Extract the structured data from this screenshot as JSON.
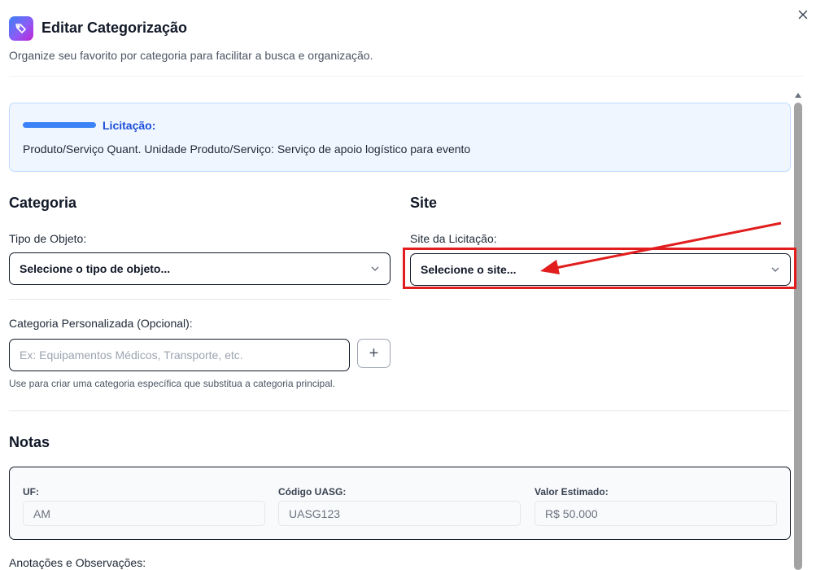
{
  "header": {
    "title": "Editar Categorização",
    "subtitle": "Organize seu favorito por categoria para facilitar a busca e organização.",
    "icon": "tag-icon",
    "close_icon": "close-icon"
  },
  "licitacao": {
    "label": "Licitação:",
    "description": "Produto/Serviço Quant. Unidade Produto/Serviço: Serviço de apoio logístico para evento"
  },
  "categoria": {
    "title": "Categoria",
    "tipo_label": "Tipo de Objeto:",
    "tipo_value": "Selecione o tipo de objeto...",
    "custom_label": "Categoria Personalizada (Opcional):",
    "custom_placeholder": "Ex: Equipamentos Médicos, Transporte, etc.",
    "add_label": "+",
    "hint": "Use para criar uma categoria específica que substitua a categoria principal."
  },
  "site": {
    "title": "Site",
    "label": "Site da Licitação:",
    "value": "Selecione o site..."
  },
  "notas": {
    "title": "Notas",
    "fields": [
      {
        "label": "UF:",
        "value": "AM"
      },
      {
        "label": "Código UASG:",
        "value": "UASG123"
      },
      {
        "label": "Valor Estimado:",
        "value": "R$ 50.000"
      }
    ],
    "annotations_label": "Anotações e Observações:"
  },
  "colors": {
    "accent": "#3b82f6",
    "highlight": "#e11d1d",
    "info_bg": "#eff6ff"
  }
}
